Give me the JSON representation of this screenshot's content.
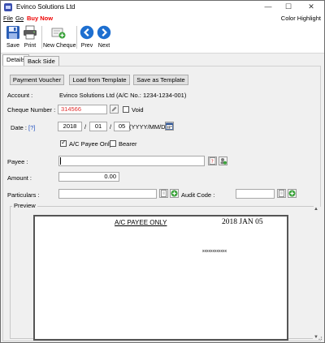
{
  "window": {
    "title": "Evinco Solutions Ltd",
    "controls": {
      "minimize": "—",
      "maximize": "☐",
      "close": "✕"
    }
  },
  "menu": {
    "file": "File",
    "go": "Go",
    "buy_now": "Buy Now",
    "color_highlight": "Color Highlight"
  },
  "toolbar": {
    "save": "Save",
    "print": "Print",
    "new_cheque": "New Cheque",
    "prev": "Prev",
    "next": "Next"
  },
  "tabs": {
    "details": "Details",
    "back_side": "Back Side"
  },
  "details": {
    "payment_voucher": "Payment Voucher",
    "load_template": "Load from Template",
    "save_template": "Save as Template",
    "account_label": "Account :",
    "account_value": "Evinco Solutions Ltd (A/C No.: 1234-1234-001)",
    "cheque_number_label": "Cheque Number :",
    "cheque_number_value": "314566",
    "void_label": "Void",
    "date_label": "Date :",
    "date_help": "[?]",
    "date_year": "2018",
    "date_month": "01",
    "date_day": "05",
    "date_sep1": "/",
    "date_sep2": "/",
    "date_format": "(YYYY/MM/DD)",
    "ac_payee_label": "A/C Payee Only",
    "bearer_label": "Bearer",
    "payee_label": "Payee :",
    "payee_value": "",
    "amount_label": "Amount :",
    "amount_value": "0.00",
    "particulars_label": "Particulars :",
    "particulars_value": "",
    "audit_code_label": "Audit Code :",
    "audit_code_value": "",
    "preview_label": "Preview"
  },
  "cheque_preview": {
    "ac_payee_text": "A/C PAYEE ONLY",
    "date_text": "2018 JAN 05",
    "amount_mask": "xxxxxxxxxxxx"
  },
  "colors": {
    "accent_red": "#e00000",
    "cheque_number": "#e03030",
    "toolbar_blue": "#1e6fd0"
  }
}
